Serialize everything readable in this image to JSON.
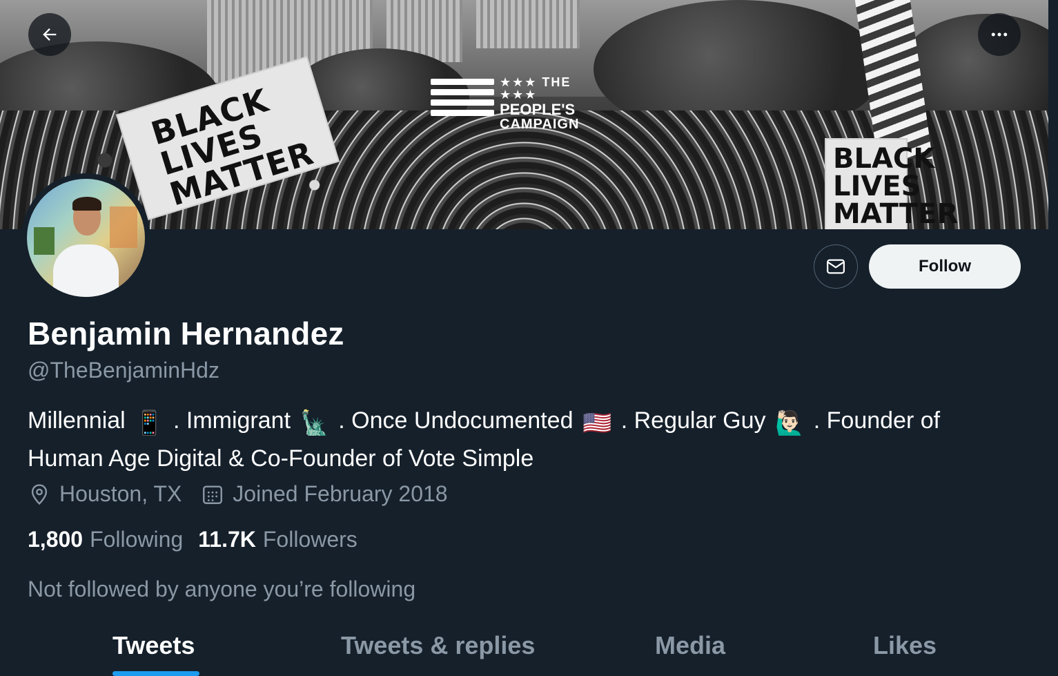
{
  "banner": {
    "left_sign_text": "BLACK LIVES MATTER",
    "right_sign_text": "BLACK LIVES MATTER",
    "logo_line1": "★★★ THE ★★★",
    "logo_line2": "PEOPLE'S",
    "logo_line3": "CAMPAIGN"
  },
  "profile": {
    "name": "Benjamin Hernandez",
    "handle": "@TheBenjaminHdz",
    "bio_parts": [
      "Millennial",
      "📱",
      ". Immigrant",
      "🗽",
      ". Once Undocumented",
      "🇺🇸",
      ". Regular Guy",
      "🙋🏻‍♂️",
      ". Founder of Human Age Digital & Co-Founder of Vote Simple"
    ],
    "location": "Houston, TX",
    "joined": "Joined February 2018",
    "following_count": "1,800",
    "following_label": "Following",
    "followers_count": "11.7K",
    "followers_label": "Followers",
    "not_followed_text": "Not followed by anyone you’re following"
  },
  "actions": {
    "follow_label": "Follow"
  },
  "tabs": [
    {
      "label": "Tweets",
      "active": true
    },
    {
      "label": "Tweets & replies",
      "active": false
    },
    {
      "label": "Media",
      "active": false
    },
    {
      "label": "Likes",
      "active": false
    }
  ],
  "colors": {
    "background": "#15202b",
    "secondary_text": "#8b98a5",
    "accent": "#1d9bf0",
    "follow_button_bg": "#eff3f4"
  },
  "icons": {
    "back": "arrow-left-icon",
    "more": "more-horizontal-icon",
    "message": "envelope-icon",
    "location": "location-pin-icon",
    "calendar": "calendar-icon"
  }
}
